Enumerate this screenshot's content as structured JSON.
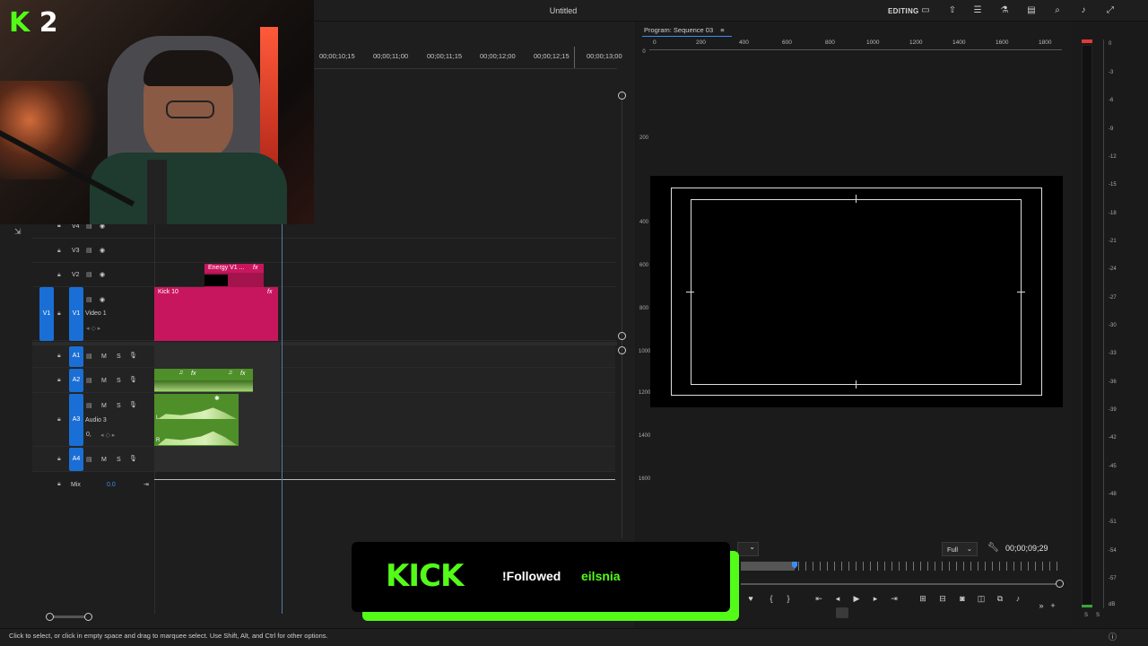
{
  "app": {
    "title": "Untitled",
    "workspace": "EDITING"
  },
  "webcam": {
    "badge_k": "K",
    "badge_num": "2"
  },
  "timeline": {
    "ruler": [
      "00;00;10;15",
      "00;00;11;00",
      "00;00;11;15",
      "00;00;12;00",
      "00;00;12;15",
      "00;00;13;00"
    ],
    "video_tracks": [
      {
        "name": "V4"
      },
      {
        "name": "V3"
      },
      {
        "name": "V2"
      },
      {
        "name": "V1",
        "source": "V1",
        "label": "Video 1"
      }
    ],
    "audio_tracks": [
      {
        "name": "A1",
        "m": "M",
        "s": "S"
      },
      {
        "name": "A2",
        "m": "M",
        "s": "S"
      },
      {
        "name": "A3",
        "m": "M",
        "s": "S",
        "label": "Audio 3",
        "level": "0,"
      },
      {
        "name": "A4",
        "m": "M",
        "s": "S"
      }
    ],
    "mix": {
      "label": "Mix",
      "value": "0.0"
    },
    "clips": {
      "v2": {
        "name": "Energy V1 ...",
        "fx": "fx"
      },
      "v1": {
        "name": "Kick 10",
        "fx": "fx"
      },
      "a2_fx": "fx"
    },
    "audio_channel_labels": {
      "left": "L",
      "right": "R"
    }
  },
  "program": {
    "title": "Program: Sequence 03",
    "menu_icon": "≡",
    "hruler": [
      "0",
      "200",
      "400",
      "600",
      "800",
      "1000",
      "1200",
      "1400",
      "1600",
      "1800"
    ],
    "vruler": [
      "0",
      "200",
      "400",
      "600",
      "800",
      "1000",
      "1200",
      "1400",
      "1600"
    ],
    "zoom": "Full",
    "timecode": "00;00;09;29"
  },
  "meter": {
    "labels": [
      "0",
      "-3",
      "-6",
      "-9",
      "-12",
      "-15",
      "-18",
      "-21",
      "-24",
      "-27",
      "-30",
      "-33",
      "-36",
      "-39",
      "-42",
      "-45",
      "-48",
      "-51",
      "-54",
      "-57",
      "dB"
    ],
    "bottom": [
      "S",
      "S"
    ]
  },
  "overlay": {
    "logo": "KICK",
    "text": "!Followed",
    "user": "eilsnia",
    "accent": "#53fc18"
  },
  "status": {
    "text": "Click to select, or click in empty space and drag to marquee select. Use Shift, Alt, and Ctrl for other options."
  }
}
